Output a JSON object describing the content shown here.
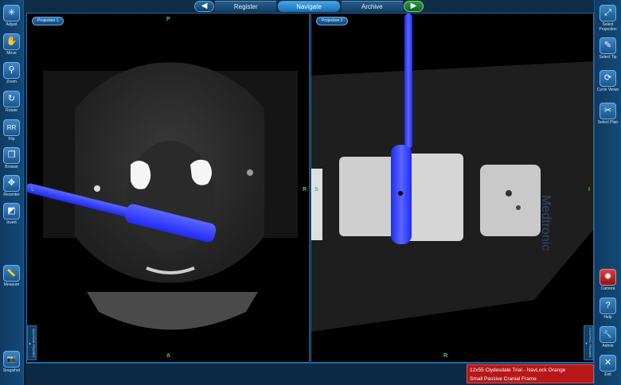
{
  "top_nav": {
    "back_glyph": "◀",
    "forward_glyph": "▶",
    "tabs": [
      {
        "label": "Register"
      },
      {
        "label": "Navigate"
      },
      {
        "label": "Archive"
      }
    ]
  },
  "left_toolbar": [
    {
      "label": "Adjust",
      "glyph": "✳"
    },
    {
      "label": "Move",
      "glyph": "✋"
    },
    {
      "label": "Zoom",
      "glyph": "⚲"
    },
    {
      "label": "Rotate",
      "glyph": "↻"
    },
    {
      "label": "Flip",
      "glyph": "RR"
    },
    {
      "label": "Browse",
      "glyph": "❐"
    },
    {
      "label": "Recenter",
      "glyph": "✥"
    },
    {
      "label": "Invert",
      "glyph": "◩"
    },
    {
      "label": "Measure",
      "glyph": "📏"
    },
    {
      "label": "Snapshot",
      "glyph": "📷"
    }
  ],
  "right_toolbar": [
    {
      "label": "Select Projection",
      "glyph": "⤢"
    },
    {
      "label": "Select Tip",
      "glyph": "✎"
    },
    {
      "label": "Cycle Views",
      "glyph": "⟳"
    },
    {
      "label": "Select Plan",
      "glyph": "✂"
    },
    {
      "label": "Camera",
      "glyph": "✺"
    },
    {
      "label": "Help",
      "glyph": "?"
    },
    {
      "label": "Admin",
      "glyph": "🔧"
    },
    {
      "label": "Exit",
      "glyph": "✕"
    }
  ],
  "viewports": {
    "left": {
      "projection_label": "Projection 1",
      "orient": {
        "top": "P",
        "left": "L",
        "right": "R",
        "bottom": "A"
      }
    },
    "right": {
      "projection_label": "Projection 2",
      "orient": {
        "left": "S",
        "right": "I",
        "bottom": "R"
      }
    }
  },
  "watermark": "Medtronic",
  "side_tabs": {
    "left": "MACHINE FRAMES ▲",
    "right": "CONTROL FRAMES ▼"
  },
  "status": {
    "line1": "12x55 Clydesdale Trial - NavLock Orange",
    "line2": "Small Passive Cranial Frame"
  },
  "colors": {
    "tool_blue": "#2f3bff",
    "orient_green": "#3fd15a",
    "status_red": "#b81818"
  }
}
